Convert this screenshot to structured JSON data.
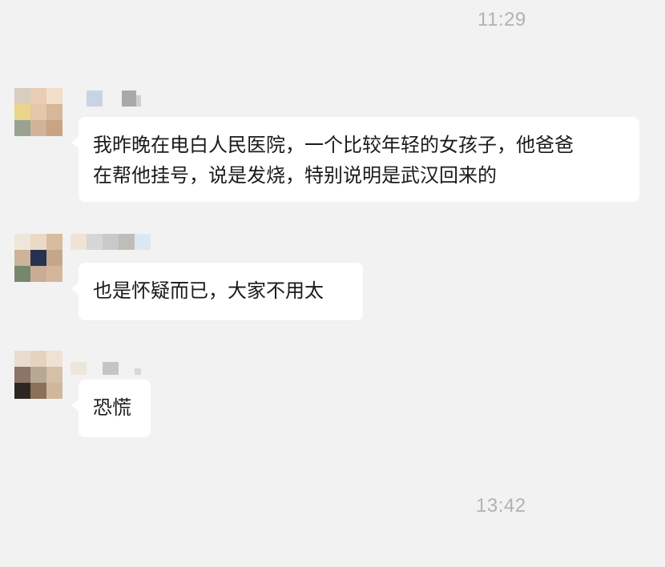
{
  "chat": {
    "timestamps": [
      "11:29",
      "13:42"
    ],
    "messages": [
      {
        "lines": [
          "我昨晚在电白人民医院，一个比较年轻的女孩子，他爸爸",
          "在帮他挂号，说是发烧，特别说明是武汉回来的"
        ]
      },
      {
        "lines": [
          "也是怀疑而已，大家不用太"
        ]
      },
      {
        "lines": [
          "恐慌"
        ]
      }
    ]
  },
  "colors": {
    "background": "#f2f2f2",
    "bubble": "#ffffff",
    "timestamp": "#b2b2b2",
    "text": "#1a1a1a"
  }
}
